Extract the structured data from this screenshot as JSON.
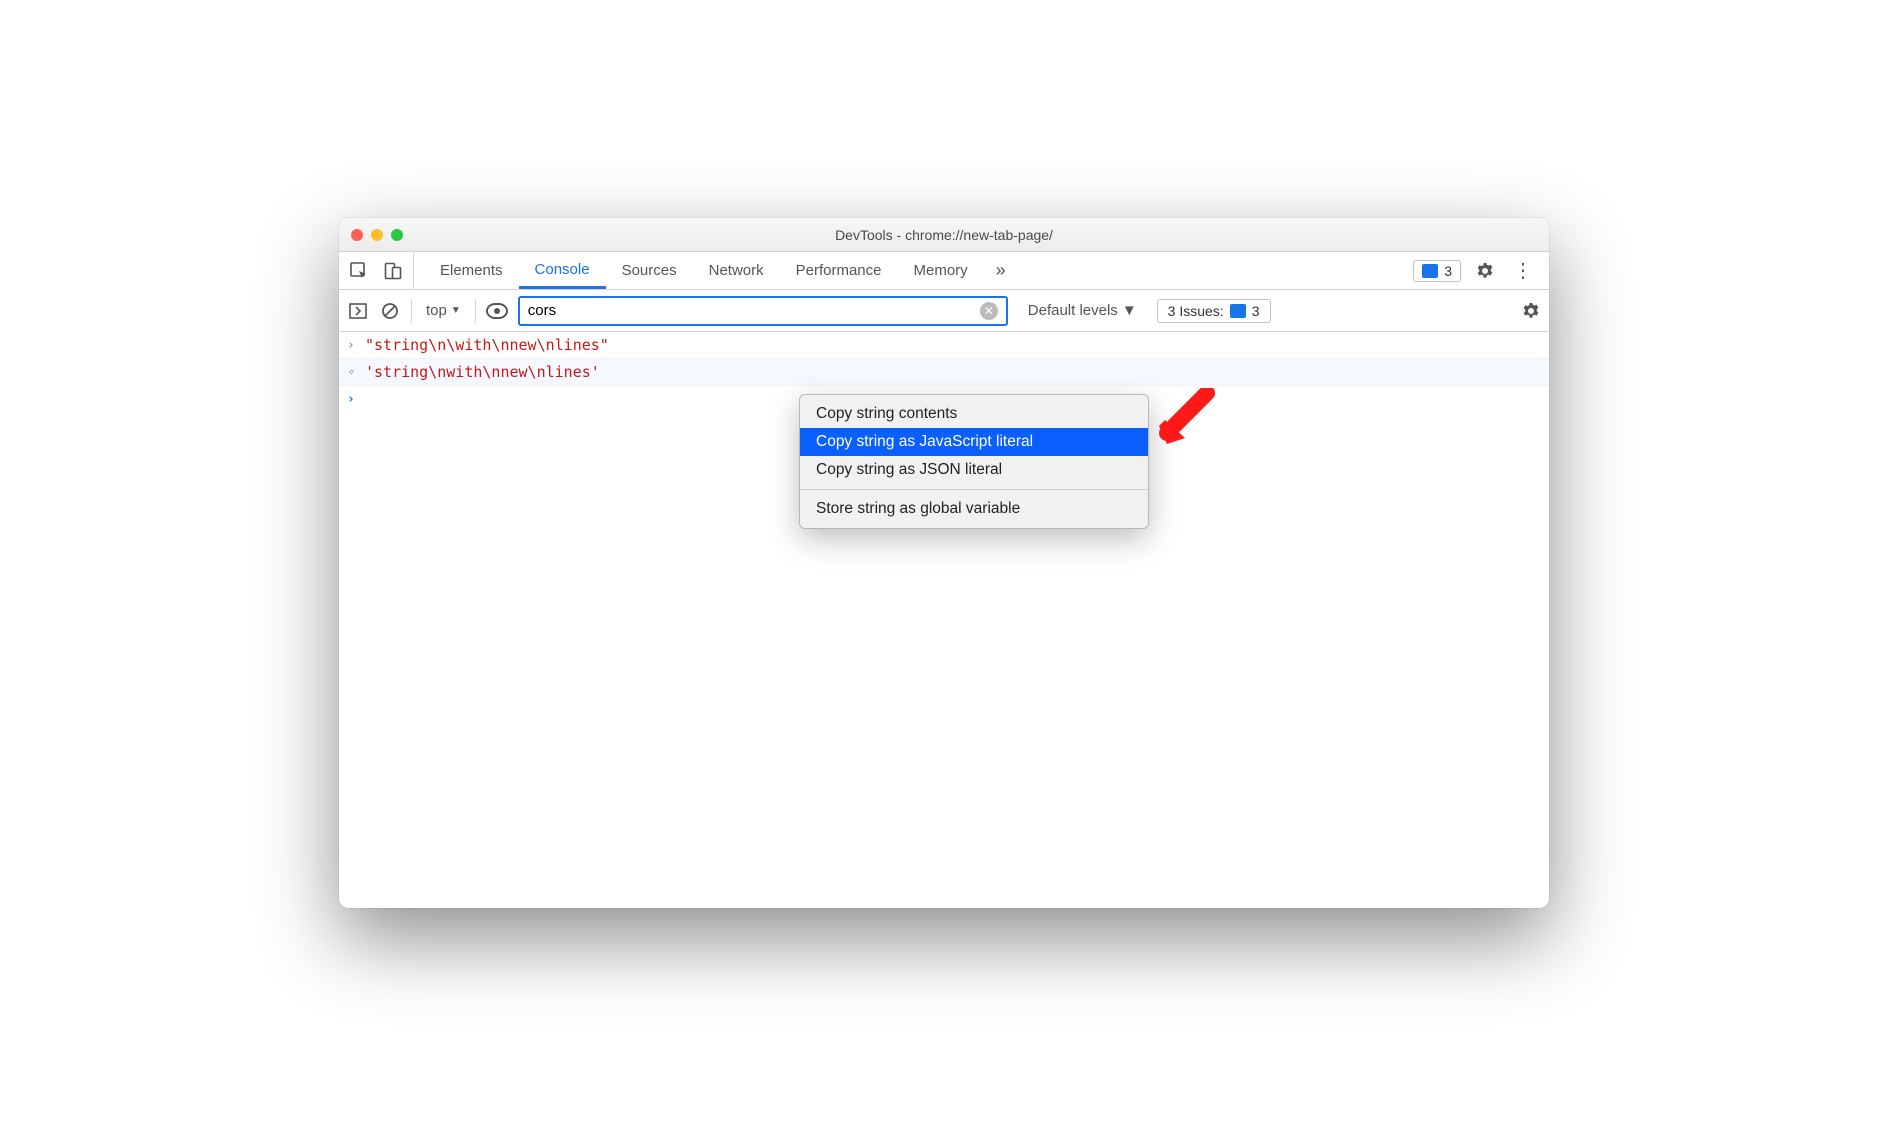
{
  "window": {
    "title": "DevTools - chrome://new-tab-page/"
  },
  "tabs": {
    "items": [
      "Elements",
      "Console",
      "Sources",
      "Network",
      "Performance",
      "Memory"
    ],
    "active_index": 1,
    "overflow_glyph": "»",
    "warnings_count": "3"
  },
  "filterbar": {
    "context_label": "top",
    "filter_value": "cors",
    "levels_label": "Default levels",
    "issues_label": "3 Issues:",
    "issues_count": "3"
  },
  "console": {
    "rows": [
      {
        "kind": "in",
        "text": "\"string\\n\\with\\nnew\\nlines\""
      },
      {
        "kind": "out",
        "text": "'string\\nwith\\nnew\\nlines'"
      }
    ]
  },
  "context_menu": {
    "items": [
      "Copy string contents",
      "Copy string as JavaScript literal",
      "Copy string as JSON literal",
      "Store string as global variable"
    ],
    "selected_index": 1,
    "separator_after_index": 2
  }
}
